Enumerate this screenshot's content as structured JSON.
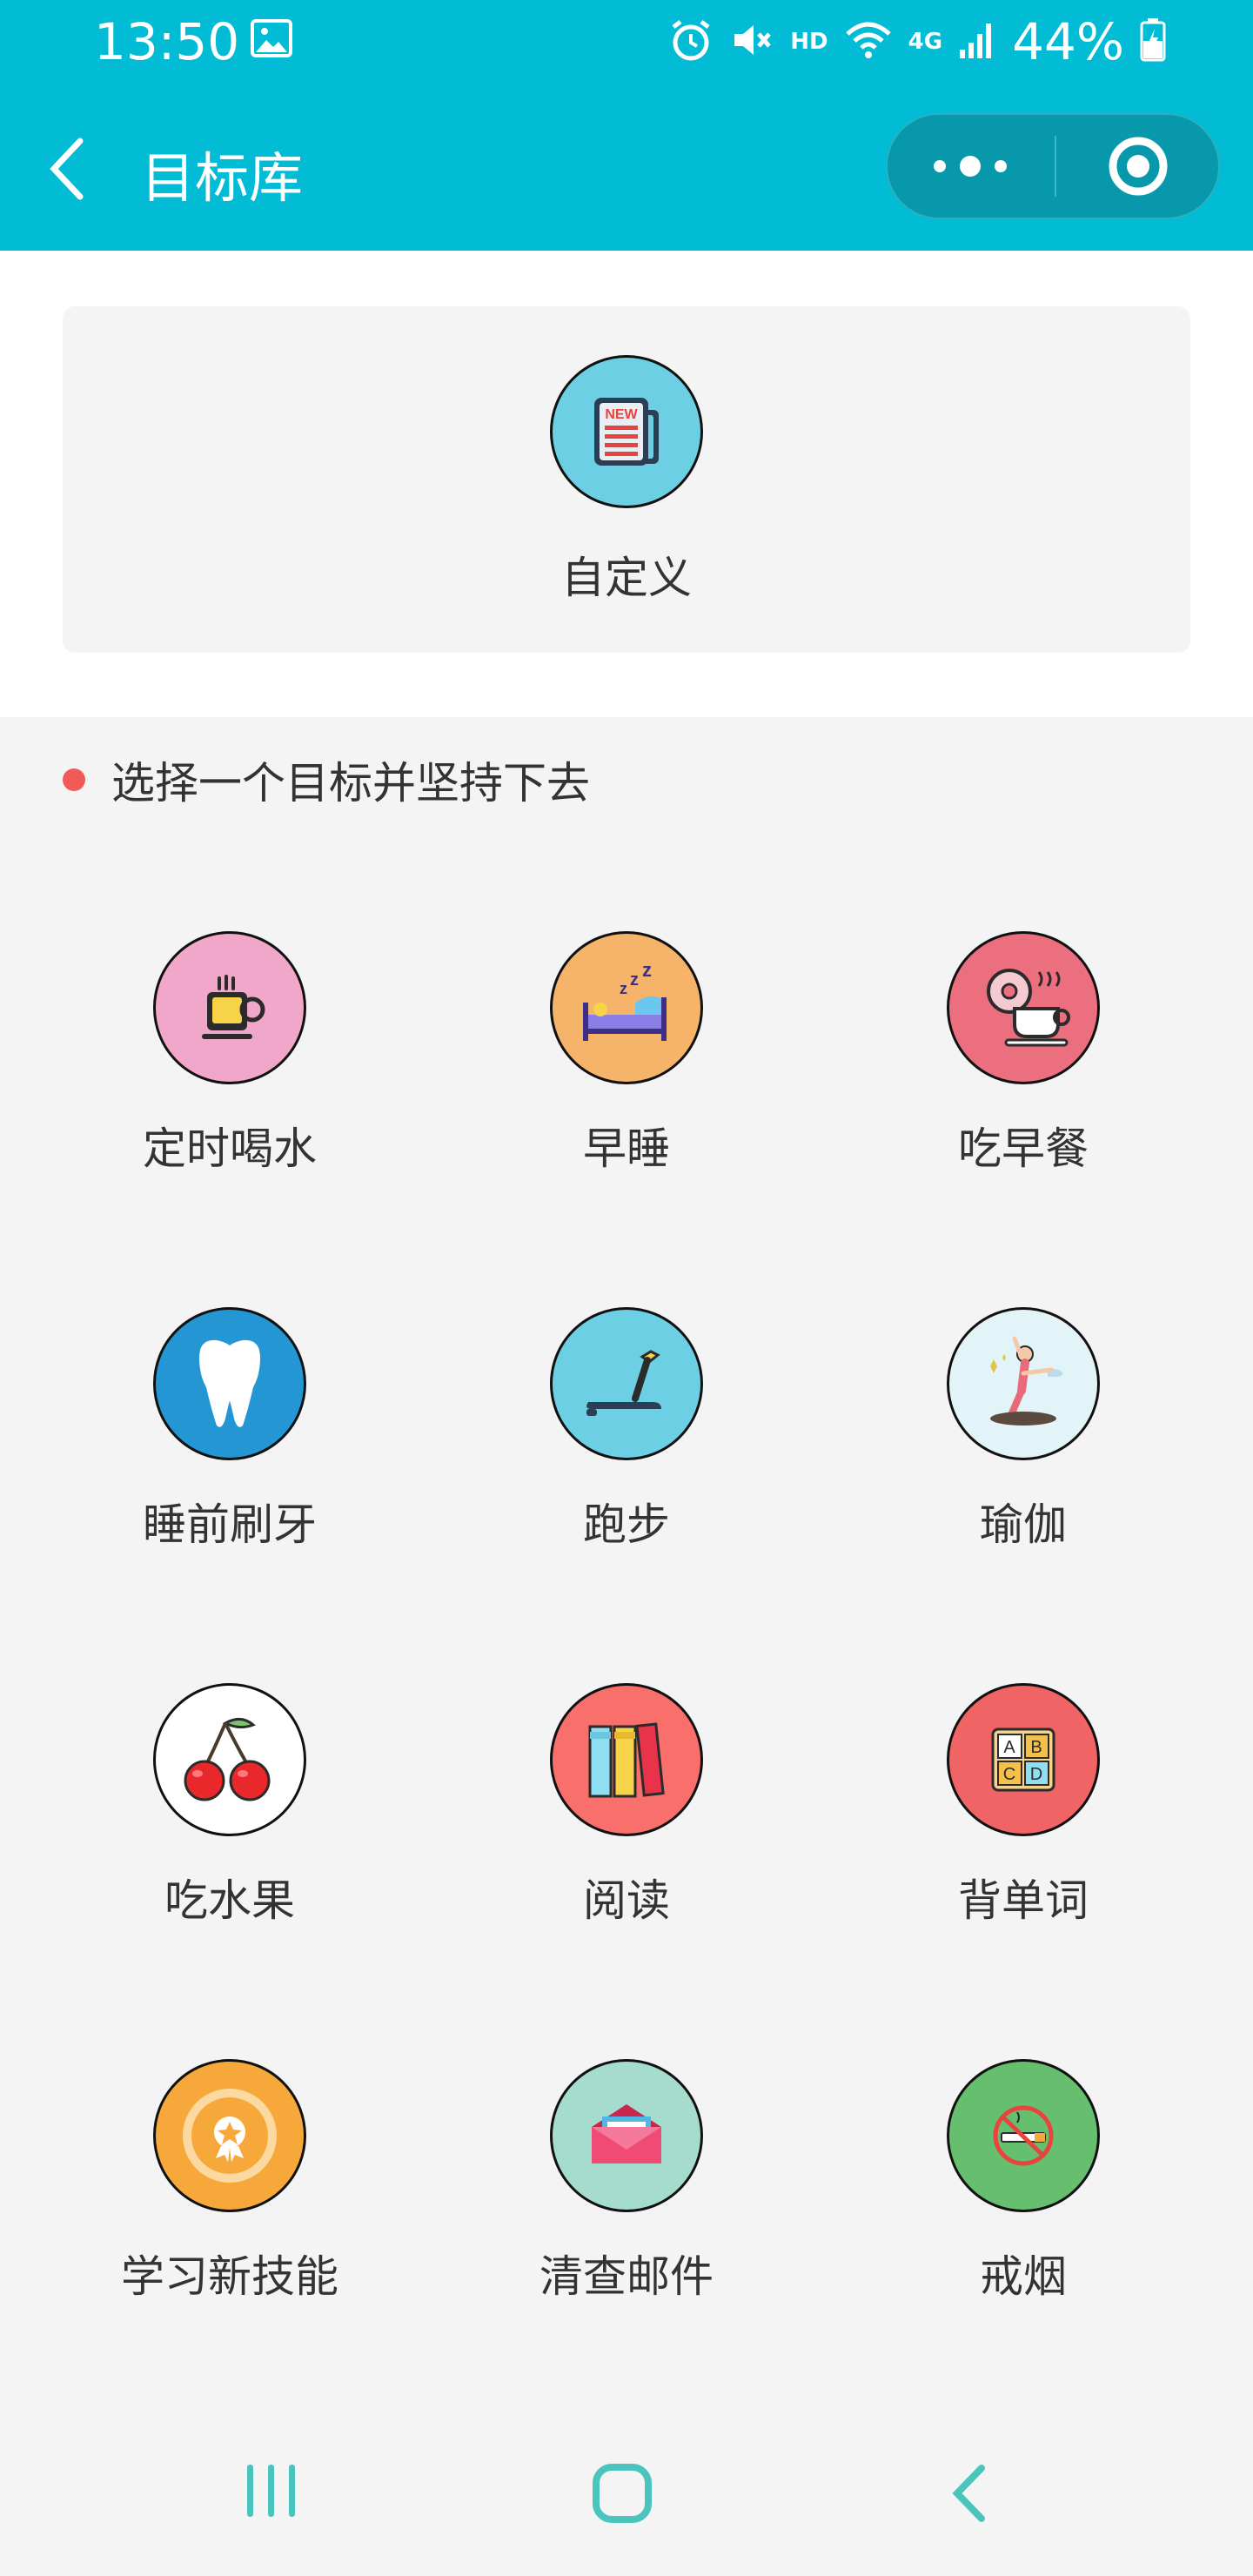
{
  "status_bar": {
    "time": "13:50",
    "network": "HD",
    "signal": "4G",
    "battery": "44%"
  },
  "nav": {
    "title": "目标库"
  },
  "custom": {
    "label": "自定义",
    "icon": "newspaper-icon"
  },
  "section": {
    "title": "选择一个目标并坚持下去"
  },
  "goals": [
    {
      "label": "定时喝水",
      "icon": "coffee-cup-icon",
      "bg": "#f1a7c9"
    },
    {
      "label": "早睡",
      "icon": "sleeping-bed-icon",
      "bg": "#f6b36a"
    },
    {
      "label": "吃早餐",
      "icon": "donut-coffee-icon",
      "bg": "#ec6f80"
    },
    {
      "label": "睡前刷牙",
      "icon": "tooth-icon",
      "bg": "#2396d3"
    },
    {
      "label": "跑步",
      "icon": "treadmill-icon",
      "bg": "#6ccfe3"
    },
    {
      "label": "瑜伽",
      "icon": "yoga-icon",
      "bg": "#e2f4f8"
    },
    {
      "label": "吃水果",
      "icon": "cherry-icon",
      "bg": "#ffffff"
    },
    {
      "label": "阅读",
      "icon": "books-icon",
      "bg": "#f86f6b"
    },
    {
      "label": "背单词",
      "icon": "abc-blocks-icon",
      "bg": "#f06465"
    },
    {
      "label": "学习新技能",
      "icon": "medal-icon",
      "bg": "#f7a83a"
    },
    {
      "label": "清查邮件",
      "icon": "envelope-icon",
      "bg": "#a6dccd"
    },
    {
      "label": "戒烟",
      "icon": "no-smoking-icon",
      "bg": "#66bf6e"
    }
  ]
}
